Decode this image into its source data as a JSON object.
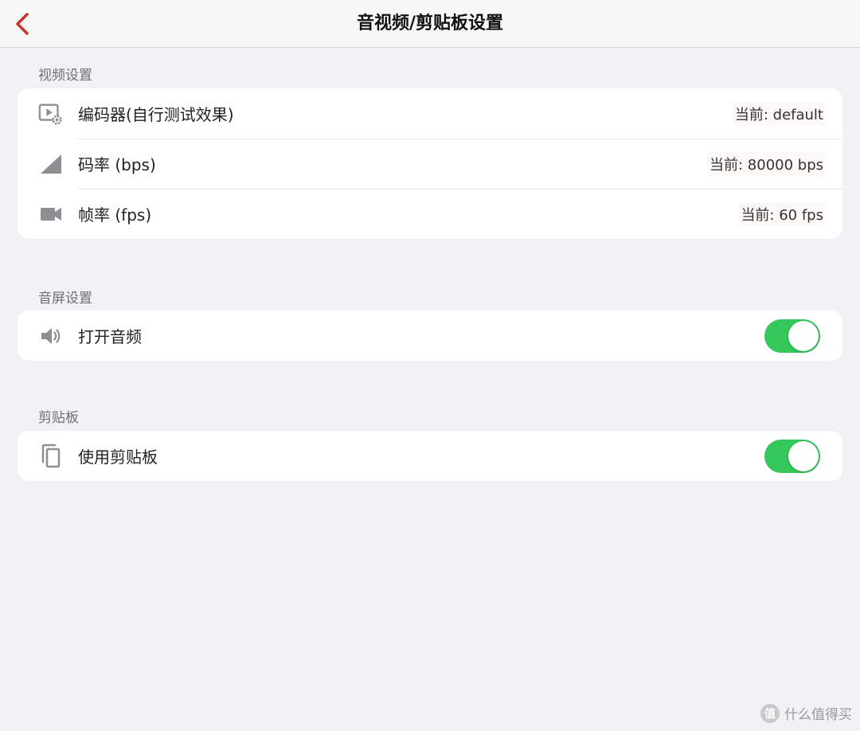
{
  "navbar": {
    "title": "音视频/剪贴板设置",
    "back_icon": "chevron-left-icon",
    "accent_color": "#c0392b"
  },
  "video_section": {
    "header": "视频设置",
    "rows": [
      {
        "icon": "video-settings-icon",
        "label": "编码器(自行测试效果)",
        "value": "当前: default"
      },
      {
        "icon": "signal-icon",
        "label": "码率 (bps)",
        "value": "当前: 80000 bps"
      },
      {
        "icon": "video-camera-icon",
        "label": "帧率 (fps)",
        "value": "当前: 60 fps"
      }
    ]
  },
  "audio_section": {
    "header": "音屏设置",
    "rows": [
      {
        "icon": "speaker-icon",
        "label": "打开音频",
        "toggle_on": true
      }
    ]
  },
  "clipboard_section": {
    "header": "剪贴板",
    "rows": [
      {
        "icon": "copy-icon",
        "label": "使用剪贴板",
        "toggle_on": true
      }
    ]
  },
  "toggle_color": "#34c759",
  "watermark": {
    "badge": "值",
    "text": "什么值得买"
  }
}
